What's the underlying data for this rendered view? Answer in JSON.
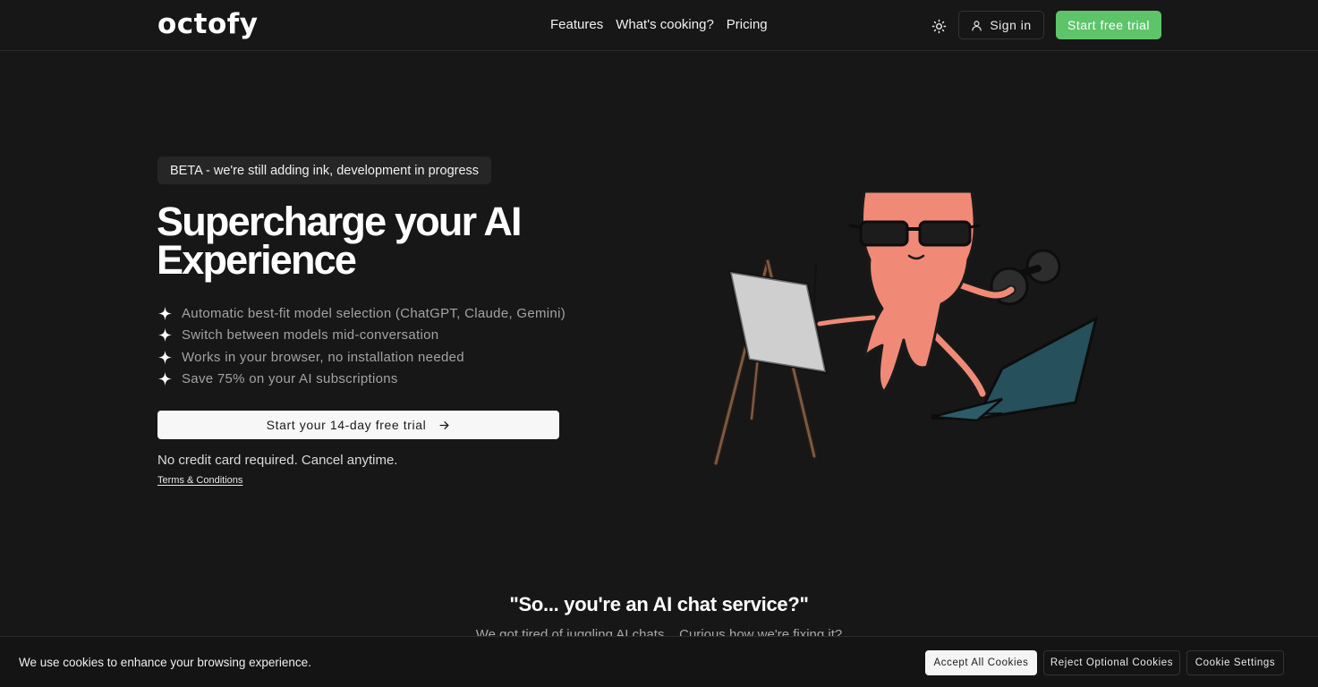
{
  "header": {
    "logo": "octofy",
    "nav": [
      "Features",
      "What's cooking?",
      "Pricing"
    ],
    "sign_in_label": "Sign in",
    "start_trial_label": "Start free trial"
  },
  "hero": {
    "badge": "BETA - we're still adding ink, development in progress",
    "title": "Supercharge your AI Experience",
    "features": [
      "Automatic best-fit model selection (ChatGPT, Claude, Gemini)",
      "Switch between models mid-conversation",
      "Works in your browser, no installation needed",
      "Save 75% on your AI subscriptions"
    ],
    "cta_label": "Start your 14-day free trial",
    "no_card_note": "No credit card required. Cancel anytime.",
    "terms_link": "Terms & Conditions"
  },
  "section": {
    "title": "\"So... you're an AI chat service?\"",
    "subtitle": "We got tired of juggling AI chats... Curious how we're fixing it?"
  },
  "cookie_banner": {
    "message": "We use cookies to enhance your browsing experience.",
    "accept_label": "Accept All Cookies",
    "reject_label": "Reject Optional Cookies",
    "settings_label": "Cookie Settings"
  },
  "colors": {
    "background": "#171717",
    "accent_green": "#5ec46a",
    "octopus": "#f08a77"
  }
}
